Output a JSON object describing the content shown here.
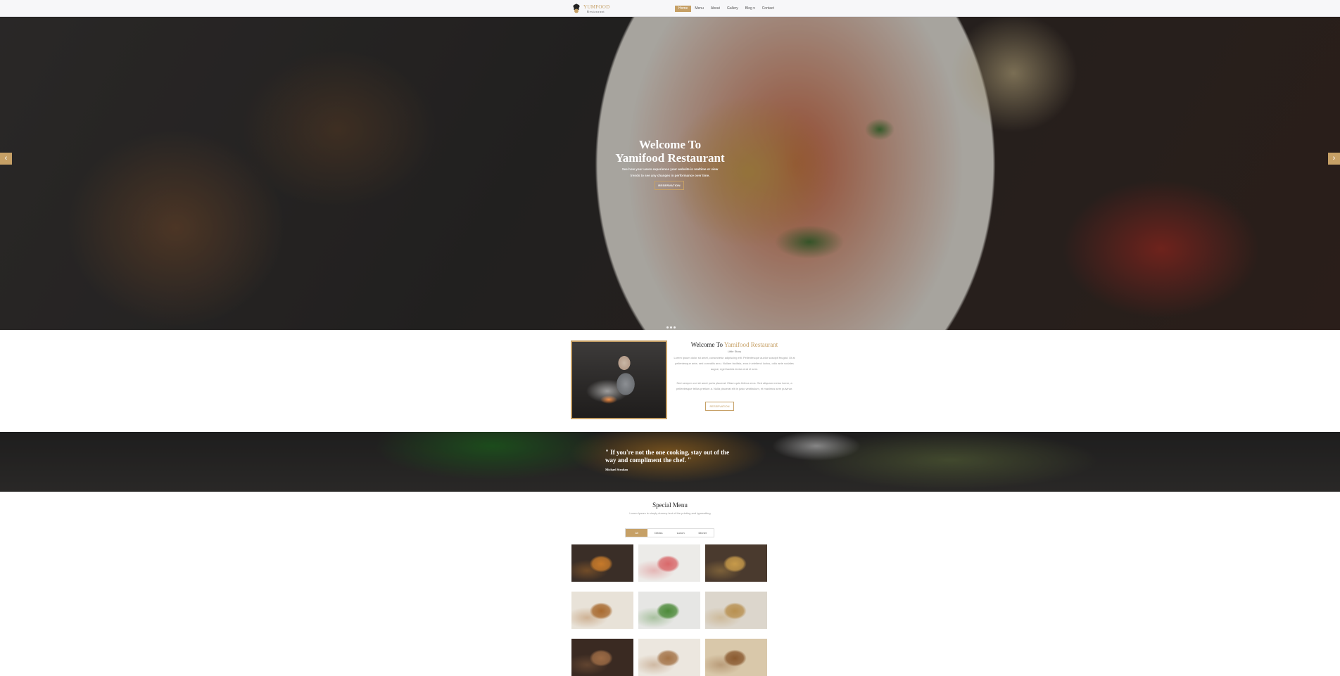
{
  "nav": {
    "logo": {
      "line1": "YUMFOOD",
      "line2": "Restaurant"
    },
    "items": [
      {
        "label": "Home",
        "active": true
      },
      {
        "label": "Menu",
        "active": false
      },
      {
        "label": "About",
        "active": false
      },
      {
        "label": "Gallery",
        "active": false
      },
      {
        "label": "Blog ▾",
        "active": false
      },
      {
        "label": "Contact",
        "active": false
      }
    ]
  },
  "hero": {
    "title_line1": "Welcome To",
    "title_line2": "Yamifood Restaurant",
    "subtitle_line1": "See how your users experience your website in realtime or view",
    "subtitle_line2": "trends to see any changes in performance over time.",
    "button_label": "RESERVATION",
    "prev_arrow": "‹",
    "next_arrow": "›",
    "slide_count": 3,
    "accent_color": "#c6a066"
  },
  "about": {
    "title_prefix": "Welcome To",
    "title_highlight": "Yamifood Restaurant",
    "small_label": "Little Story",
    "paragraph1": "Lorem ipsum dolor sit amet, consectetur adipiscing elit. Pellentesque auctor suscipit feugiat. Ut at pellentesque ante, sed convallis arcu. Nullam facilisis, eros in eleifend luctus, odio ante sodales augue, eget lacinia lectus erat et sem.",
    "paragraph2": "Sed semper orci sit amet porta placerat. Etiam quis finibus eros. Sed aliquam metus lorem, a pellentesque tellus pretium a. Nulla placerat elit in justo vestibulum, et maximus sem pulvinar.",
    "button_label": "RESERVATION"
  },
  "quote": {
    "text": "\" If you're not the one cooking, stay out of the way and compliment the chef. \"",
    "author": "Michael Strahan"
  },
  "special_menu": {
    "title": "Special Menu",
    "subtitle": "Lorem Ipsum is simply dummy text of the printing and typesetting",
    "filters": [
      {
        "label": "All",
        "active": true
      },
      {
        "label": "Drinks",
        "active": false
      },
      {
        "label": "Lunch",
        "active": false
      },
      {
        "label": "Dinner",
        "active": false
      }
    ],
    "items": [
      {
        "icon": "cocktail-photo",
        "colors": [
          "#3a2e27",
          "#c77a2a"
        ]
      },
      {
        "icon": "watermelon-drink-photo",
        "colors": [
          "#ecebe8",
          "#d9686a"
        ]
      },
      {
        "icon": "beer-snack-photo",
        "colors": [
          "#4a3a2e",
          "#c79a4a"
        ]
      },
      {
        "icon": "burger-photo",
        "colors": [
          "#e8e2d8",
          "#a86a2f"
        ]
      },
      {
        "icon": "salad-bowls-photo",
        "colors": [
          "#e6e6e4",
          "#4d8a3a"
        ]
      },
      {
        "icon": "plated-dish-photo",
        "colors": [
          "#dcd6cc",
          "#b89050"
        ]
      },
      {
        "icon": "dinner-plates-photo",
        "colors": [
          "#3a2a22",
          "#9c6b45"
        ]
      },
      {
        "icon": "dinner-table-photo",
        "colors": [
          "#ece7df",
          "#a47448"
        ]
      },
      {
        "icon": "dessert-board-photo",
        "colors": [
          "#d9c8aa",
          "#8a5a30"
        ]
      }
    ]
  }
}
